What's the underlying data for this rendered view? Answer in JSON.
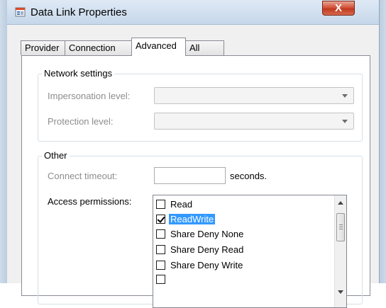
{
  "window": {
    "title": "Data Link Properties",
    "close_label": "X",
    "icon": "data-link-icon"
  },
  "tabs": [
    {
      "label": "Provider",
      "active": false
    },
    {
      "label": "Connection",
      "active": false
    },
    {
      "label": "Advanced",
      "active": true
    },
    {
      "label": "All",
      "active": false
    }
  ],
  "network_settings": {
    "title": "Network settings",
    "impersonation_label": "Impersonation level:",
    "impersonation_value": "",
    "protection_label": "Protection level:",
    "protection_value": ""
  },
  "other": {
    "title": "Other",
    "connect_timeout_label": "Connect timeout:",
    "connect_timeout_value": "",
    "connect_timeout_unit": "seconds.",
    "access_permissions_label": "Access permissions:",
    "permissions": [
      {
        "label": "Read",
        "checked": false,
        "selected": false
      },
      {
        "label": "ReadWrite",
        "checked": true,
        "selected": true
      },
      {
        "label": "Share Deny None",
        "checked": false,
        "selected": false
      },
      {
        "label": "Share Deny Read",
        "checked": false,
        "selected": false
      },
      {
        "label": "Share Deny Write",
        "checked": false,
        "selected": false
      }
    ]
  },
  "colors": {
    "selection": "#3399ff",
    "close_button": "#c0391f"
  }
}
